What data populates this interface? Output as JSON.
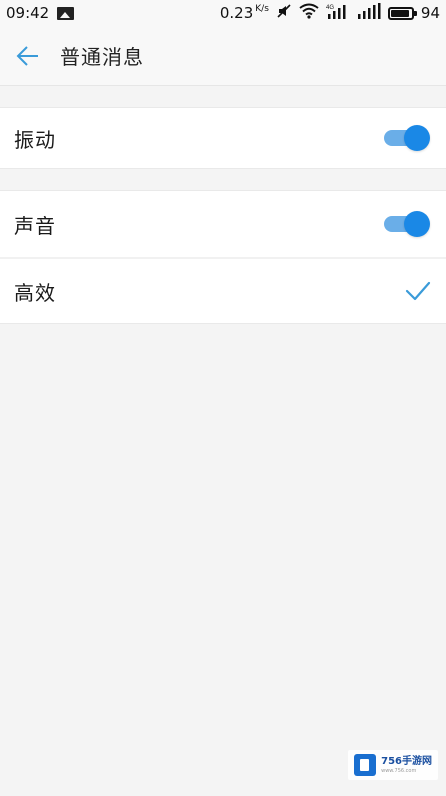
{
  "status_bar": {
    "time": "09:42",
    "speed_value": "0.23",
    "speed_unit": "K/s",
    "battery": "94",
    "network_label": "4G"
  },
  "header": {
    "title": "普通消息"
  },
  "settings": {
    "vibration": {
      "label": "振动",
      "enabled": true
    },
    "sound": {
      "label": "声音",
      "enabled": true
    },
    "efficient": {
      "label": "高效",
      "checked": true
    }
  },
  "watermark": {
    "text": "756手游网",
    "sub": "www.756.com"
  },
  "colors": {
    "accent": "#1a88e6",
    "toggle_track": "#6aaee8",
    "back_arrow": "#3a9bd9",
    "background": "#f4f4f4"
  }
}
